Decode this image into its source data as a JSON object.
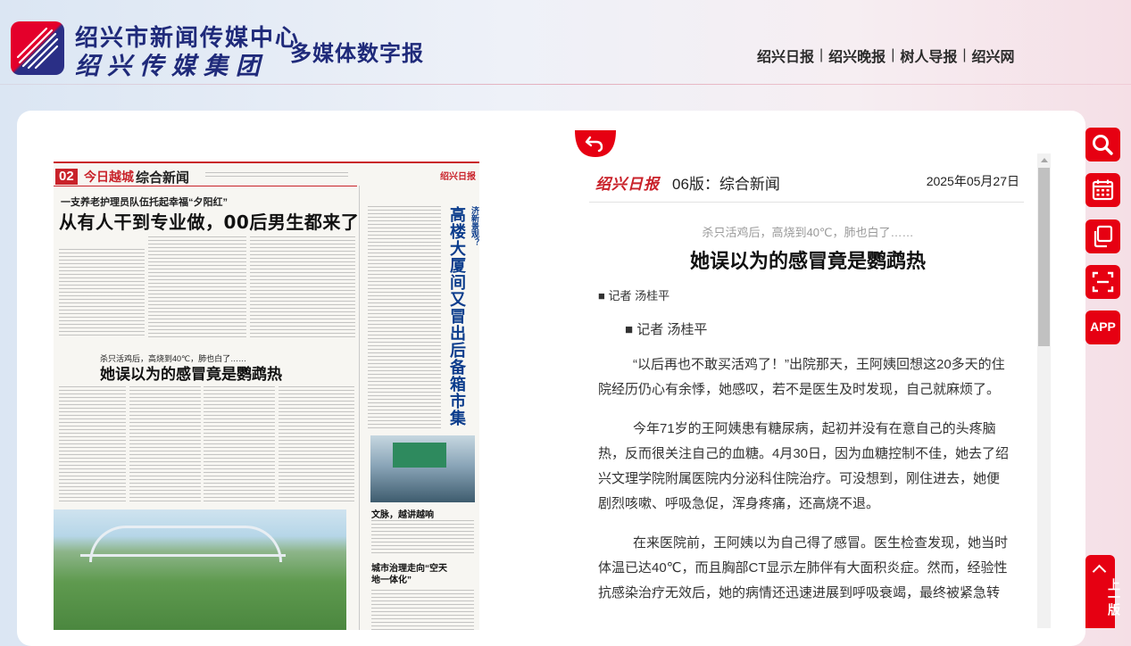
{
  "header": {
    "org_name_line1": "绍兴市新闻传媒中心",
    "org_name_line2": "绍兴传媒集团",
    "product_name": "多媒体数字报",
    "nav_links": [
      {
        "label": "绍兴日报"
      },
      {
        "label": "绍兴晚报"
      },
      {
        "label": "树人导报"
      },
      {
        "label": "绍兴网"
      }
    ],
    "separator": "|"
  },
  "page_thumbnail": {
    "page_tag": "02",
    "page_brand": "今日越城",
    "section": "综合新闻",
    "masthead_logo": "绍兴日报",
    "kicker_1": "一支养老护理员队伍托起幸福“夕阳红”",
    "headline_1": "从有人干到专业做，00后男生都来了",
    "kicker_2": "杀只活鸡后，高烧到40℃，肺也白了……",
    "headline_2": "她误以为的感冒竟是鹦鹉热",
    "side_headline": "高楼大厦间又冒出后备箱市集",
    "side_kicker": "「创」吴越街区“摆”台临时到常驻，成为逛夏又一个夜经济新景观？",
    "caption_1": "文脉，越讲越响",
    "headline_3": "城市治理走向“空天地一体化”"
  },
  "article": {
    "paper_brand": "绍兴日报",
    "edition": "06版：综合新闻",
    "date": "2025年05月27日",
    "subtitle": "杀只活鸡后，高烧到40℃，肺也白了……",
    "title": "她误以为的感冒竟是鹦鹉热",
    "byline_top": "■ 记者 汤桂平",
    "byline_body": "■ 记者 汤桂平",
    "paragraphs": [
      "“以后再也不敢买活鸡了！”出院那天，王阿姨回想这20多天的住院经历仍心有余悸，她感叹，若不是医生及时发现，自己就麻烦了。",
      "今年71岁的王阿姨患有糖尿病，起初并没有在意自己的头疼脑热，反而很关注自己的血糖。4月30日，因为血糖控制不佳，她去了绍兴文理学院附属医院内分泌科住院治疗。可没想到，刚住进去，她便剧烈咳嗽、呼吸急促，浑身疼痛，还高烧不退。",
      "在来医院前，王阿姨以为自己得了感冒。医生检查发现，她当时体温已达40℃，而且胸部CT显示左肺伴有大面积炎症。然而，经验性抗感染治疗无效后，她的病情还迅速进展到呼吸衰竭，最终被紧急转"
    ]
  },
  "tools": [
    {
      "name": "search-icon"
    },
    {
      "name": "calendar-icon"
    },
    {
      "name": "copy-icon"
    },
    {
      "name": "scan-icon"
    },
    {
      "name": "app-icon",
      "label": "APP"
    }
  ],
  "prev_page": {
    "label": "上一版"
  },
  "colors": {
    "brand_red": "#e60012",
    "brand_blue": "#1f2a7a",
    "paper_red": "#c9222a"
  }
}
